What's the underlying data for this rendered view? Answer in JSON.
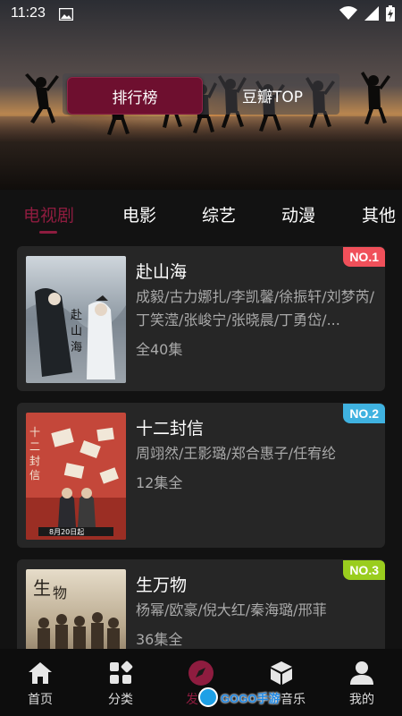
{
  "status_bar": {
    "time": "11:23"
  },
  "hero": {
    "toggle": {
      "active_label": "排行榜",
      "inactive_label": "豆瓣TOP"
    }
  },
  "tabs": [
    {
      "label": "电视剧",
      "active": true
    },
    {
      "label": "电影",
      "active": false
    },
    {
      "label": "综艺",
      "active": false
    },
    {
      "label": "动漫",
      "active": false
    },
    {
      "label": "其他",
      "active": false
    }
  ],
  "items": [
    {
      "rank": "NO.1",
      "rank_color": "#f0505a",
      "title": "赴山海",
      "cast": "成毅/古力娜扎/李凯馨/徐振轩/刘梦芮/丁笑滢/张峻宁/张晓晨/丁勇岱/...",
      "episodes": "全40集"
    },
    {
      "rank": "NO.2",
      "rank_color": "#3fb2e0",
      "title": "十二封信",
      "cast": "周翊然/王影璐/郑合惠子/任宥纶",
      "episodes": "12集全"
    },
    {
      "rank": "NO.3",
      "rank_color": "#9acd1e",
      "title": "生万物",
      "cast": "杨幂/欧豪/倪大红/秦海璐/邢菲",
      "episodes": "36集全"
    }
  ],
  "bottom_nav": [
    {
      "label": "首页",
      "icon": "home-icon"
    },
    {
      "label": "分类",
      "icon": "category-icon"
    },
    {
      "label": "发",
      "icon": "discover-icon"
    },
    {
      "label": "音乐",
      "icon": "cube-icon"
    },
    {
      "label": "我的",
      "icon": "profile-icon"
    }
  ],
  "watermark": {
    "text": "GOGO手游"
  },
  "colors": {
    "accent": "#8e1c3f",
    "card_bg": "#262626",
    "page_bg": "#121212"
  }
}
